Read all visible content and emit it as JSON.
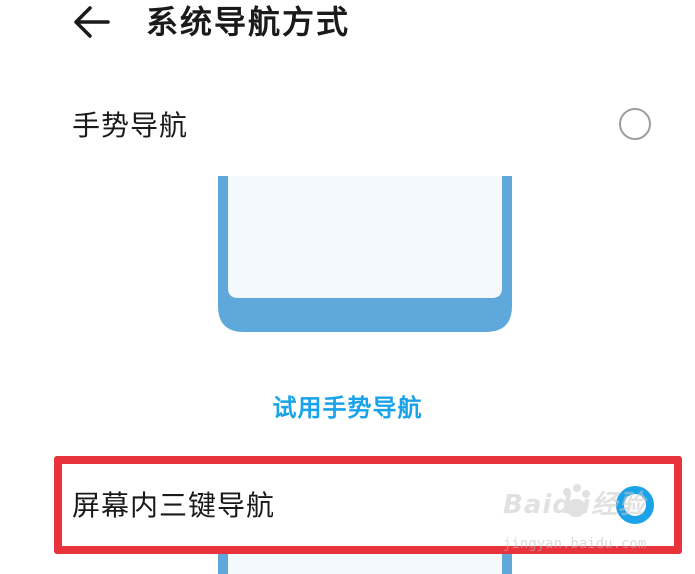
{
  "header": {
    "title": "系统导航方式",
    "back_icon": "arrow-left-icon"
  },
  "options": [
    {
      "label": "手势导航",
      "selected": false
    },
    {
      "label": "屏幕内三键导航",
      "selected": true
    }
  ],
  "try_link": "试用手势导航",
  "colors": {
    "accent": "#1aa3e8",
    "highlight": "#e8323c",
    "phone_frame": "#5fa8dc",
    "phone_screen": "#f3f9fd"
  },
  "watermark": {
    "text": "Baidu经验",
    "url": "jingyan.baidu.com"
  }
}
